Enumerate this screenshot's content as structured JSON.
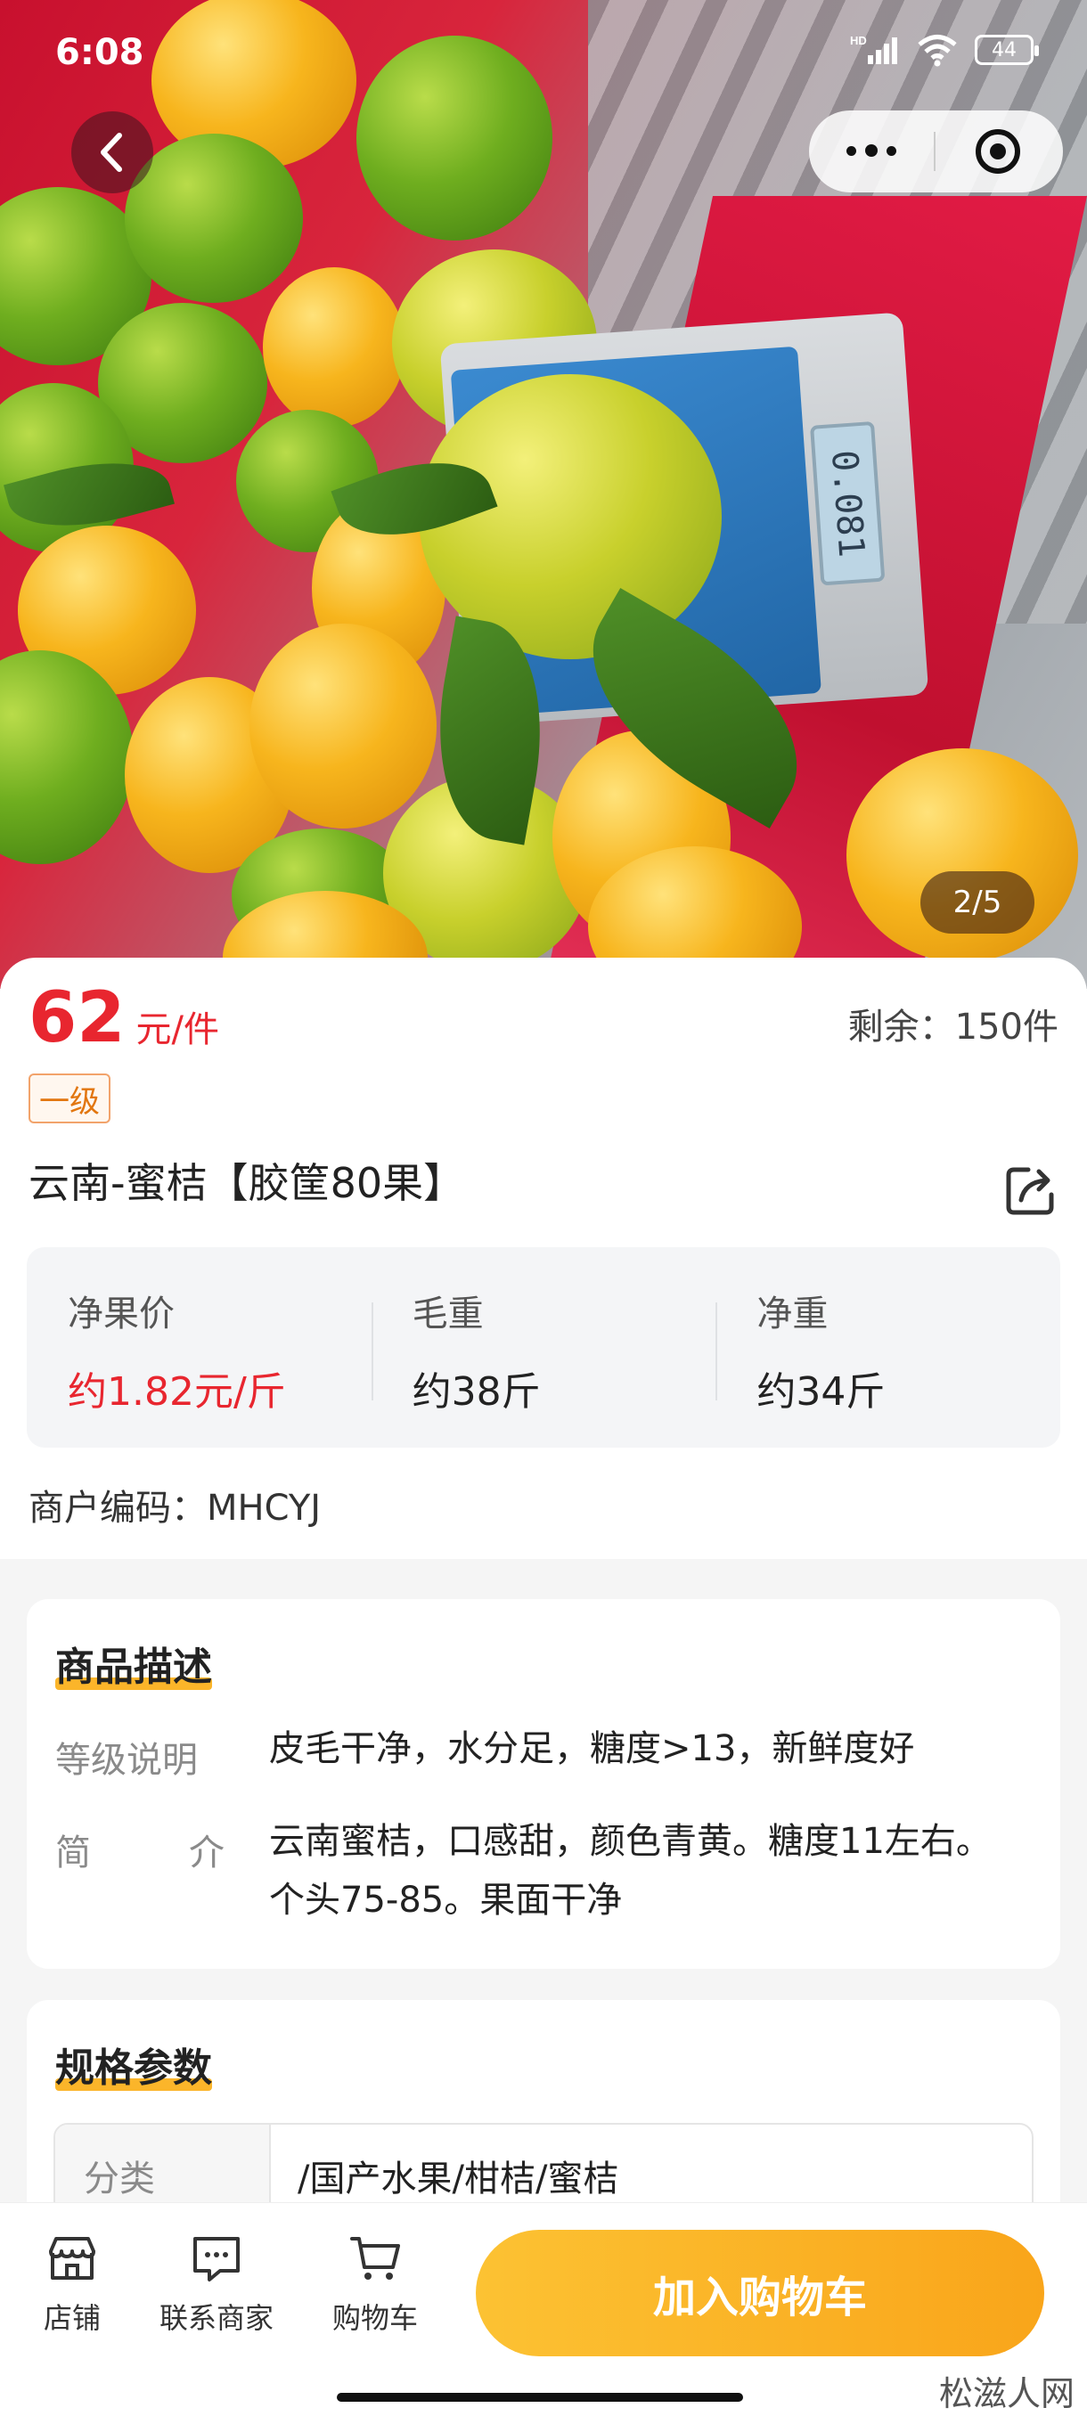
{
  "status_bar": {
    "time": "6:08",
    "network": "HD",
    "battery": "44"
  },
  "capsule": {
    "more_icon": "more-dots-icon",
    "close_icon": "target-close-icon"
  },
  "gallery": {
    "counter": "2/5",
    "scale_reading": "0.081"
  },
  "product": {
    "price": "62",
    "price_unit": "元/件",
    "stock": "剩余：150件",
    "grade": "一级",
    "title": "云南-蜜桔【胶筐80果】",
    "metrics": [
      {
        "label": "净果价",
        "value": "约1.82元/斤"
      },
      {
        "label": "毛重",
        "value": "约38斤"
      },
      {
        "label": "净重",
        "value": "约34斤"
      }
    ],
    "merchant_code": "商户编码：MHCYJ"
  },
  "description": {
    "title": "商品描述",
    "grade_label": "等级说明",
    "grade_text": "皮毛干净，水分足，糖度>13，新鲜度好",
    "intro_label_1": "简",
    "intro_label_2": "介",
    "intro_text": "云南蜜桔，口感甜，颜色青黄。糖度11左右。个头75-85。果面干净"
  },
  "specs": {
    "title": "规格参数",
    "category_label": "分类",
    "category_value": "/国产水果/柑桔/蜜桔"
  },
  "bottom_bar": {
    "shop": "店铺",
    "contact": "联系商家",
    "cart": "购物车",
    "add_to_cart": "加入购物车"
  },
  "watermark": "松滋人网",
  "colors": {
    "price_red": "#e8262f",
    "accent_orange": "#f9a51a",
    "grade_orange": "#e2760f"
  }
}
